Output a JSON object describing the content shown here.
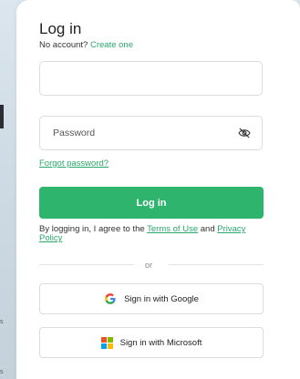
{
  "login": {
    "title": "Log in",
    "no_account": "No account?",
    "create_one": "Create one",
    "email_placeholder": "",
    "password_placeholder": "Password",
    "forgot": "Forgot password?",
    "login_button": "Log in",
    "terms_prefix": "By logging in, I agree to the ",
    "terms_link": "Terms of Use",
    "terms_mid": " and ",
    "privacy_link": "Privacy Policy",
    "or": "or",
    "google": "Sign in with Google",
    "microsoft": "Sign in with Microsoft"
  },
  "colors": {
    "accent": "#2fb46e",
    "link": "#2aa86a"
  },
  "icons": {
    "eye": "eye-slash-icon",
    "google": "google-icon",
    "microsoft": "microsoft-icon"
  }
}
